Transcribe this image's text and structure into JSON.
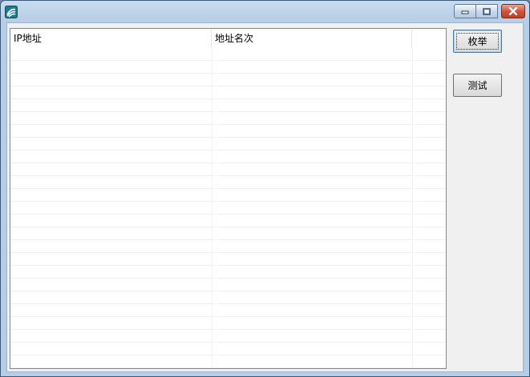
{
  "window": {
    "icon": "app-logo-icon",
    "caption_buttons": [
      "minimize-icon",
      "maximize-icon",
      "close-icon"
    ]
  },
  "listview": {
    "columns": [
      "IP地址",
      "地址名次",
      ""
    ],
    "rows": []
  },
  "buttons": {
    "enumerate_label": "枚举",
    "test_label": "测试"
  }
}
